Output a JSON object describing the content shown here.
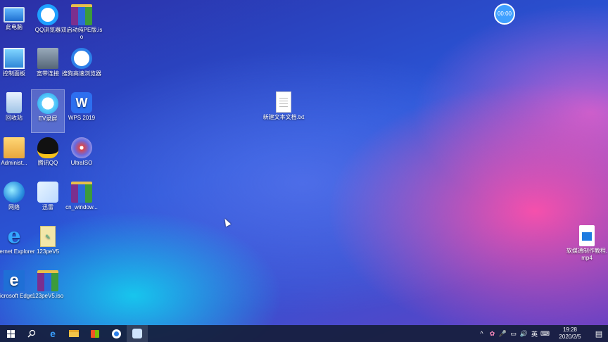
{
  "desktop_icons": [
    {
      "label": "此电脑",
      "icon": "computer-icon"
    },
    {
      "label": "QQ浏览器",
      "icon": "qq-browser-icon"
    },
    {
      "label": "双启动纯PE版.iso",
      "icon": "winrar-archive-icon"
    },
    {
      "label": "控制面板",
      "icon": "control-panel-icon"
    },
    {
      "label": "宽带连接",
      "icon": "broadband-icon"
    },
    {
      "label": "搜狗高速浏览器",
      "icon": "sogou-browser-icon"
    },
    {
      "label": "回收站",
      "icon": "recycle-bin-icon"
    },
    {
      "label": "EV录屏",
      "icon": "ev-recorder-icon"
    },
    {
      "label": "WPS 2019",
      "icon": "wps-icon"
    },
    {
      "label": "Administ...",
      "icon": "user-folder-icon"
    },
    {
      "label": "腾讯QQ",
      "icon": "qq-icon"
    },
    {
      "label": "UltraISO",
      "icon": "ultraiso-icon"
    },
    {
      "label": "网络",
      "icon": "network-icon"
    },
    {
      "label": "迅雷",
      "icon": "xunlei-icon"
    },
    {
      "label": "cn_window...",
      "icon": "winrar-archive-icon"
    },
    {
      "label": "Internet Explorer",
      "icon": "internet-explorer-icon"
    },
    {
      "label": "123peV5",
      "icon": "notepad-file-icon"
    },
    {
      "label": "Microsoft Edge",
      "icon": "edge-icon"
    },
    {
      "label": "123peV5.iso",
      "icon": "winrar-archive-icon"
    },
    {
      "label": "新建文本文档.txt",
      "icon": "text-file-icon"
    },
    {
      "label": "软媒通制作教程.mp4",
      "icon": "video-file-icon"
    }
  ],
  "recorder_timer": "00:00",
  "taskbar": {
    "apps": [
      "start-icon",
      "search-icon",
      "edge-icon",
      "file-explorer-icon",
      "store-icon",
      "sogou-browser-icon",
      "ev-recorder-icon"
    ],
    "tray_symbols": {
      "chevron": "^",
      "ime": "英",
      "notification": "▤"
    },
    "time": "19:28",
    "date": "2020/2/5"
  }
}
